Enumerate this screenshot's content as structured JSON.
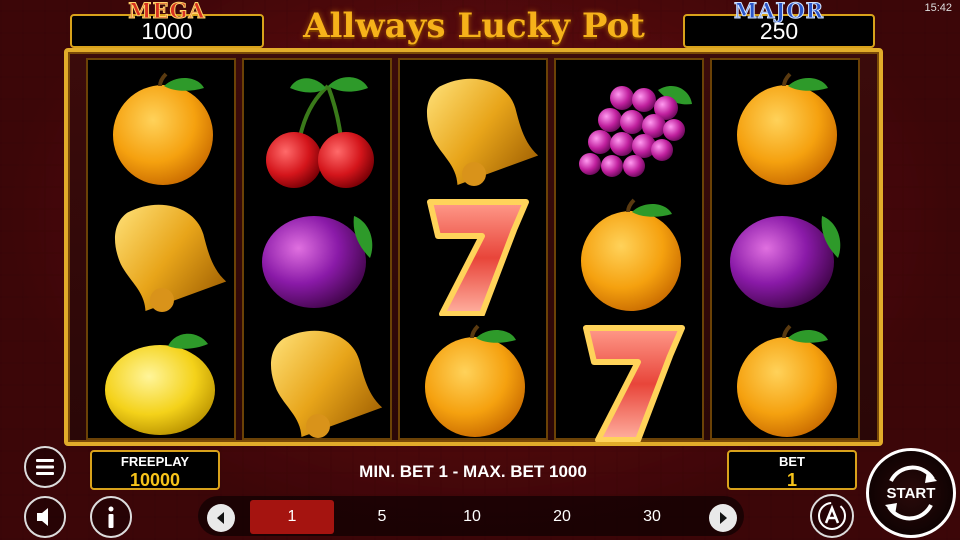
{
  "status": {
    "clock": "15:42"
  },
  "jackpots": {
    "mega": {
      "title": "MEGA",
      "value": "1000"
    },
    "major": {
      "title": "MAJOR",
      "value": "250"
    }
  },
  "game": {
    "title": "Allways Lucky Pot"
  },
  "reels": [
    [
      "orange",
      "bell",
      "lemon"
    ],
    [
      "cherry",
      "plum",
      "bell"
    ],
    [
      "bell",
      "seven",
      "orange"
    ],
    [
      "grape",
      "orange",
      "seven"
    ],
    [
      "orange",
      "plum",
      "orange"
    ]
  ],
  "freeplay": {
    "label": "FREEPLAY",
    "value": "10000"
  },
  "bet_range": "MIN. BET 1 - MAX. BET 1000",
  "bet": {
    "label": "BET",
    "value": "1"
  },
  "bet_options": [
    {
      "label": "1",
      "selected": true
    },
    {
      "label": "5",
      "selected": false
    },
    {
      "label": "10",
      "selected": false
    },
    {
      "label": "20",
      "selected": false
    },
    {
      "label": "30",
      "selected": false
    }
  ],
  "start": {
    "label": "START"
  },
  "icons": {
    "menu": "menu-icon",
    "sound": "speaker-icon",
    "info": "info-icon",
    "autoplay": "autoplay-icon",
    "prev": "chevron-left-icon",
    "next": "chevron-right-icon",
    "spin": "spin-arrows-icon"
  },
  "colors": {
    "gold": "#e2ac2a",
    "selected_bet": "#a51410",
    "mega": "#d8321f",
    "major": "#2a55c8"
  }
}
